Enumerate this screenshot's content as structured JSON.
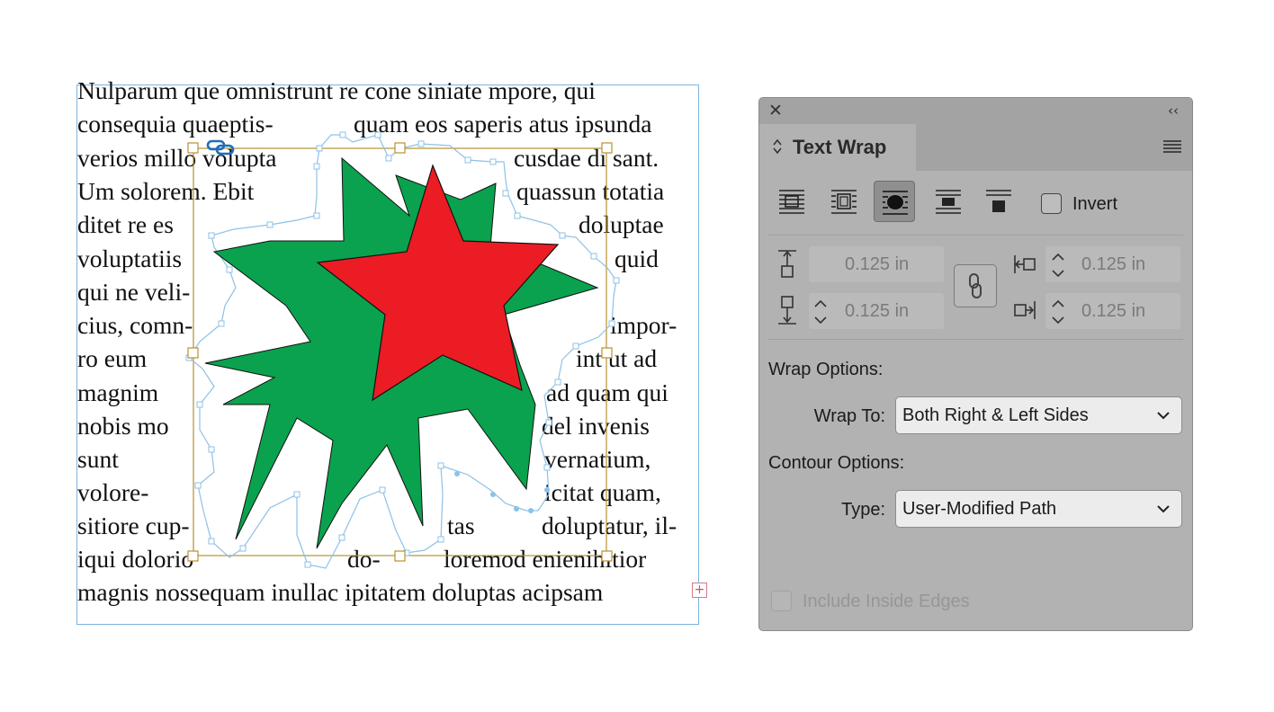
{
  "document": {
    "text_lines": [
      [
        "Nulparum que omnistrunt re cone siniate mpore, qui"
      ],
      [
        "consequia quaeptis-",
        "quam eos saperis atus ipsunda"
      ],
      [
        "verios millo volupta",
        "cusdae di sant."
      ],
      [
        "Um solorem. Ebit",
        "quassun totatia"
      ],
      [
        "ditet re es",
        "doluptae"
      ],
      [
        "voluptatiis",
        "quid"
      ],
      [
        "qui ne veli-"
      ],
      [
        "cius, comn-",
        "impor-"
      ],
      [
        "ro eum",
        "int ut ad"
      ],
      [
        "magnim",
        "ad quam qui"
      ],
      [
        "nobis mo",
        "del invenis"
      ],
      [
        "sunt",
        "vernatium,"
      ],
      [
        "volore-",
        "icitat quam,"
      ],
      [
        "sitiore cup-",
        "tas",
        "doluptatur, il-"
      ],
      [
        "iqui dolorio",
        "do-",
        "loremod enienihitior"
      ],
      [
        "magnis nossequam inullac ipitatem doluptas acipsam"
      ]
    ],
    "overset_icon": "+",
    "colors": {
      "green_star": "#0aa24e",
      "red_star": "#ec1c24",
      "frame_border": "#7fb3df",
      "wrap_path": "#8ec1e6",
      "graphic_frame": "#b8912e",
      "link_icon": "#1f6fb8"
    }
  },
  "panel": {
    "close_icon": "✕",
    "collapse_icon": "‹‹",
    "tab_chevron": "⌃⌄",
    "title": "Text Wrap",
    "wrap_buttons": [
      {
        "icon": "no-text-wrap-icon",
        "selected": false
      },
      {
        "icon": "wrap-around-bounding-box-icon",
        "selected": false
      },
      {
        "icon": "wrap-around-object-shape-icon",
        "selected": true
      },
      {
        "icon": "jump-object-icon",
        "selected": false
      },
      {
        "icon": "jump-to-next-column-icon",
        "selected": false
      }
    ],
    "invert_label": "Invert",
    "offsets": {
      "top": "0.125 in",
      "bottom": "0.125 in",
      "left": "0.125 in",
      "right": "0.125 in"
    },
    "wrap_options_label": "Wrap Options:",
    "wrap_to_label": "Wrap To:",
    "wrap_to_value": "Both Right & Left Sides",
    "contour_options_label": "Contour Options:",
    "type_label": "Type:",
    "type_value": "User-Modified Path",
    "include_inside_edges_label": "Include Inside Edges"
  }
}
